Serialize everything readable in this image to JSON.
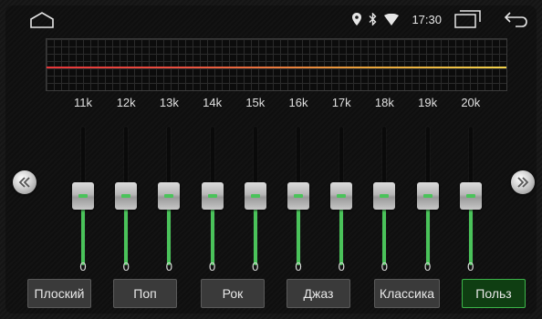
{
  "status": {
    "time": "17:30"
  },
  "bands": [
    {
      "label": "11k",
      "value": "0",
      "level": 0
    },
    {
      "label": "12k",
      "value": "0",
      "level": 0
    },
    {
      "label": "13k",
      "value": "0",
      "level": 0
    },
    {
      "label": "14k",
      "value": "0",
      "level": 0
    },
    {
      "label": "15k",
      "value": "0",
      "level": 0
    },
    {
      "label": "16k",
      "value": "0",
      "level": 0
    },
    {
      "label": "17k",
      "value": "0",
      "level": 0
    },
    {
      "label": "18k",
      "value": "0",
      "level": 0
    },
    {
      "label": "19k",
      "value": "0",
      "level": 0
    },
    {
      "label": "20k",
      "value": "0",
      "level": 0
    }
  ],
  "presets": [
    {
      "label": "Плоский",
      "active": false
    },
    {
      "label": "Поп",
      "active": false
    },
    {
      "label": "Рок",
      "active": false
    },
    {
      "label": "Джаз",
      "active": false
    },
    {
      "label": "Классика",
      "active": false
    },
    {
      "label": "Польз",
      "active": true
    }
  ],
  "icons": {
    "home": "home-icon",
    "location": "location-icon",
    "bluetooth": "bluetooth-icon",
    "wifi": "wifi-icon",
    "recent_apps": "recent-apps-icon",
    "back": "back-icon",
    "prev": "chevron-double-left-icon",
    "next": "chevron-double-right-icon"
  },
  "colors": {
    "accent": "#4ac35a",
    "active_preset_bg": "#0f3e12",
    "spectrum_red": "#e8363a",
    "spectrum_yellow": "#f2d24a"
  }
}
